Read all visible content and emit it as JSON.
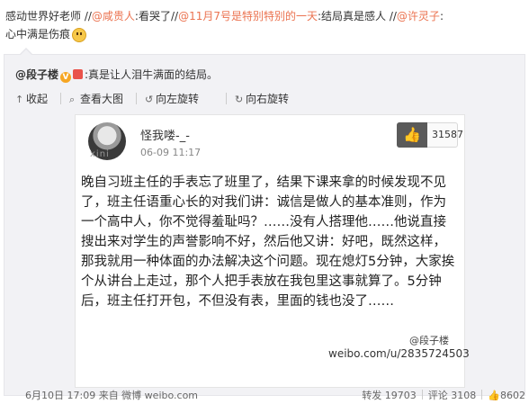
{
  "post_text": {
    "part1": "感动世界好老师 //",
    "mention1": "@咸贵人",
    "part2": ":看哭了//",
    "mention2": "@11月7号是特别特别的一天",
    "part3": ":结局真是感人 //",
    "mention3": "@许灵子",
    "part4": ":",
    "part5": "心中满是伤痕"
  },
  "retweet": {
    "user": "@段子楼",
    "badge": "V",
    "message": ":真是让人泪牛满面的结局。"
  },
  "toolbar": {
    "collapse": "收起",
    "view_large": "查看大图",
    "rotate_left": "向左旋转",
    "rotate_right": "向右旋转"
  },
  "photo": {
    "avatar_mark": "xini",
    "name": "怪我喽-_-",
    "time": "06-09 11:17",
    "likes": "31587",
    "body": "晚自习班主任的手表忘了班里了，结果下课来拿的时候发现不见了，班主任语重心长的对我们讲：诚信是做人的基本准则，作为一个高中人，你不觉得羞耻吗？……没有人搭理他……他说直接搜出来对学生的声誉影响不好，然后他又讲：好吧，既然这样，那我就用一种体面的办法解决这个问题。现在熄灯5分钟，大家挨个从讲台上走过，那个人把手表放在我包里这事就算了。5分钟后，班主任打开包，不但没有表，里面的钱也没了……",
    "watermark_user": "@段子楼",
    "watermark_url": "weibo.com/u/2835724503"
  },
  "footer": {
    "timestamp": "6月10日 17:09 来自 微博 weibo.com",
    "repost": "转发 19703",
    "comment": "评论 3108",
    "like": "8602"
  },
  "colors": {
    "link": "#eb7350",
    "card_bg": "#f2f2f5"
  },
  "icons": [
    "smiley-emoji-icon",
    "verified-badge-icon",
    "gift-icon",
    "collapse-icon",
    "zoom-icon",
    "rotate-left-icon",
    "rotate-right-icon",
    "thumbs-up-icon",
    "like-icon"
  ]
}
